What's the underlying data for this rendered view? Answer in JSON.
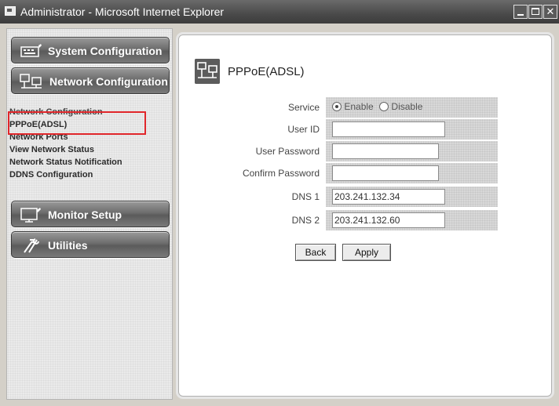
{
  "window": {
    "title": "Administrator - Microsoft Internet Explorer"
  },
  "sidebar": {
    "menus": [
      {
        "label": "System Configuration",
        "icon": "keyboard-icon"
      },
      {
        "label": "Network Configuration",
        "icon": "network-icon"
      },
      {
        "label": "Monitor Setup",
        "icon": "monitor-icon"
      },
      {
        "label": "Utilities",
        "icon": "tools-icon"
      }
    ],
    "submenu": [
      "Network Configuration",
      "PPPoE(ADSL)",
      "Network Ports",
      "View Network Status",
      "Network Status Notification",
      "DDNS Configuration"
    ],
    "highlighted_item": "PPPoE(ADSL)"
  },
  "page": {
    "title": "PPPoE(ADSL)"
  },
  "form": {
    "service": {
      "label": "Service",
      "options": [
        "Enable",
        "Disable"
      ],
      "selected": "Enable"
    },
    "user_id": {
      "label": "User ID",
      "value": ""
    },
    "user_password": {
      "label": "User Password",
      "value": ""
    },
    "confirm_password": {
      "label": "Confirm Password",
      "value": ""
    },
    "dns1": {
      "label": "DNS 1",
      "value": "203.241.132.34"
    },
    "dns2": {
      "label": "DNS 2",
      "value": "203.241.132.60"
    }
  },
  "buttons": {
    "back": "Back",
    "apply": "Apply"
  },
  "colors": {
    "highlight_box": "#e0262a",
    "menu_button": "#6d6d6d"
  }
}
